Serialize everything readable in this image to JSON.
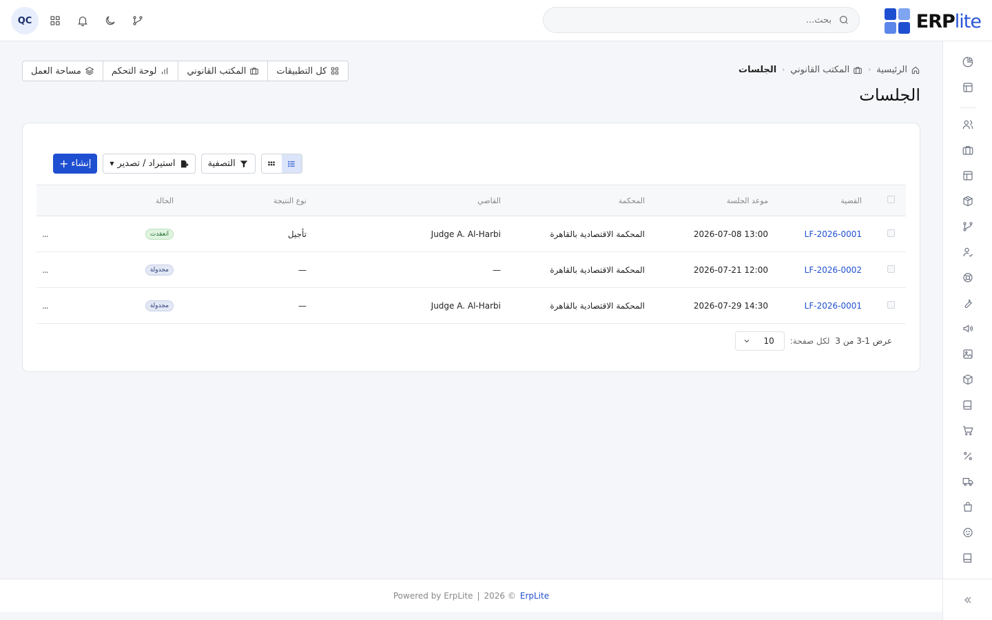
{
  "app": {
    "logo_text_bold": "ERP",
    "logo_text_light": "lite",
    "logo_colors": [
      "#1f4fd1",
      "#7fa4f0",
      "#5b86ea",
      "#1f4fd1"
    ]
  },
  "header": {
    "search_placeholder": "بحث...",
    "avatar_initials": "QC"
  },
  "breadcrumb": {
    "home": "الرئيسية",
    "section": "المكتب القانوني",
    "current": "الجلسات"
  },
  "page": {
    "title": "الجلسات"
  },
  "quick_links": {
    "all_apps": "كل التطبيقات",
    "legal_office": "المكتب القانوني",
    "dashboard": "لوحة التحكم",
    "workspace": "مساحة العمل"
  },
  "toolbar": {
    "create": "إنشاء",
    "import_export": "استيراد / تصدير",
    "filter": "التصفية"
  },
  "table": {
    "headers": {
      "case": "القضية",
      "session_date": "موعد الجلسة",
      "court": "المحكمة",
      "judge": "القاضي",
      "result_type": "نوع النتيجة",
      "status": "الحالة"
    },
    "rows": [
      {
        "case": "LF-2026-0001",
        "date": "2026-07-08 13:00",
        "court": "المحكمة الاقتصادية بالقاهرة",
        "judge": "Judge A. Al-Harbi",
        "result": "تأجيل",
        "status": "انعقدت",
        "actions": "..."
      },
      {
        "case": "LF-2026-0002",
        "date": "2026-07-21 12:00",
        "court": "المحكمة الاقتصادية بالقاهرة",
        "judge": "—",
        "result": "—",
        "status": "مجدولة",
        "actions": "..."
      },
      {
        "case": "LF-2026-0001",
        "date": "2026-07-29 14:30",
        "court": "المحكمة الاقتصادية بالقاهرة",
        "judge": "Judge A. Al-Harbi",
        "result": "—",
        "status": "مجدولة",
        "actions": "..."
      }
    ]
  },
  "pagination": {
    "summary": "عرض 1-3 من 3",
    "per_page_label": "لكل صفحة:",
    "per_page_value": "10"
  },
  "footer": {
    "powered": "Powered by ErpLite",
    "divider": "|",
    "copyright": "2026 ©",
    "brand": "ErpLite"
  }
}
